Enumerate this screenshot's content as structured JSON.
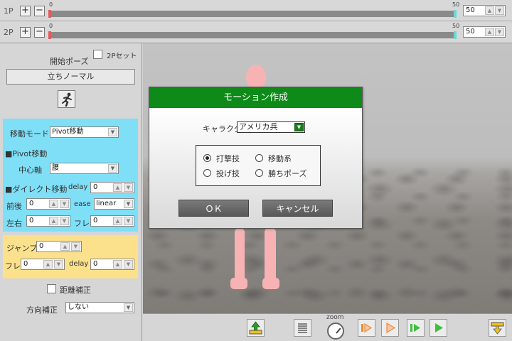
{
  "timeline": {
    "p1": {
      "label": "1P",
      "start": "0",
      "end": "50",
      "value": "50"
    },
    "p2": {
      "label": "2P",
      "start": "0",
      "end": "50",
      "value": "50"
    },
    "plus": "+",
    "minus": "−"
  },
  "left": {
    "start_pose_label": "開始ポーズ",
    "set_2p_label": "2Pセット",
    "pose_button": "立ちノーマル",
    "move_mode_label": "移動モード",
    "move_mode_value": "Pivot移動",
    "pivot_section": "■Pivot移動",
    "center_axis_label": "中心軸",
    "center_axis_value": "腰",
    "direct_section": "■ダイレクト移動",
    "delay_label": "delay",
    "delay_value": "0",
    "front_back_label": "前後",
    "front_back_value": "0",
    "ease_label": "ease",
    "ease_value": "linear",
    "left_right_label": "左右",
    "left_right_value": "0",
    "fure_label": "フレ",
    "fure_value": "0",
    "jump_label": "ジャンプ",
    "jump_value": "0",
    "jump_fure_label": "フレ",
    "jump_fure_value": "0",
    "jump_delay_label": "delay",
    "jump_delay_value": "0",
    "distance_label": "距離補正",
    "direction_label": "方向補正",
    "direction_value": "しない"
  },
  "dialog": {
    "title": "モーション作成",
    "character_label": "キャラクタ",
    "character_value": "アメリカ兵",
    "options": [
      {
        "label": "打撃技",
        "selected": true
      },
      {
        "label": "移動系",
        "selected": false
      },
      {
        "label": "投げ技",
        "selected": false
      },
      {
        "label": "勝ちポーズ",
        "selected": false
      }
    ],
    "ok": "ＯＫ",
    "cancel": "キャンセル"
  },
  "toolbar": {
    "zoom_label": "zoom"
  },
  "colors": {
    "dialog_header": "#0e8a18",
    "blue_panel": "#7fdff7",
    "yellow_panel": "#fbe18c",
    "play_orange": "#f08a3a",
    "play_green": "#3fbf3f"
  }
}
